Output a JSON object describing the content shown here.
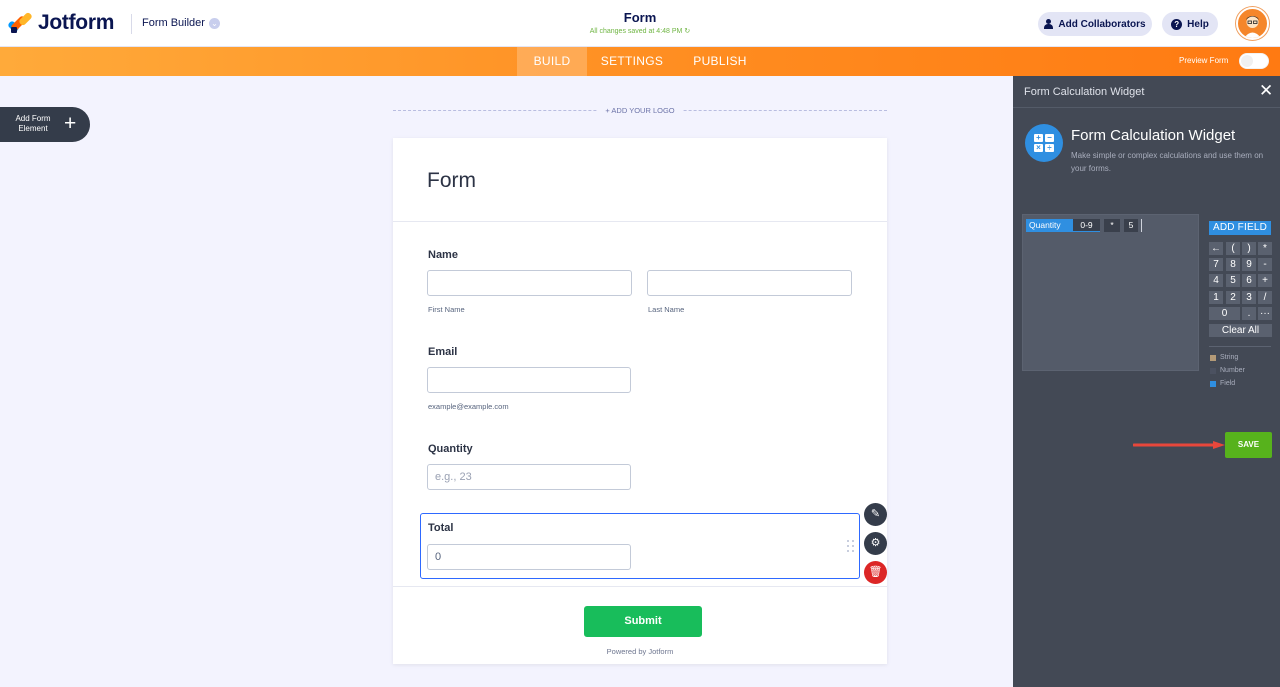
{
  "brand": {
    "name": "Jotform"
  },
  "header": {
    "builder_label": "Form Builder",
    "form_title": "Form",
    "saved_status": "All changes saved at 4:48 PM",
    "collaborators_label": "Add Collaborators",
    "help_label": "Help"
  },
  "nav": {
    "tabs": [
      {
        "label": "BUILD",
        "active": true
      },
      {
        "label": "SETTINGS",
        "active": false
      },
      {
        "label": "PUBLISH",
        "active": false
      }
    ],
    "preview_label": "Preview Form",
    "preview_on": false
  },
  "left": {
    "add_element_label": "Add Form Element"
  },
  "form": {
    "logo_placeholder": "+ ADD YOUR LOGO",
    "heading": "Form",
    "fields": {
      "name_label": "Name",
      "first_name_sub": "First Name",
      "last_name_sub": "Last Name",
      "email_label": "Email",
      "email_sub": "example@example.com",
      "quantity_label": "Quantity",
      "quantity_placeholder": "e.g., 23",
      "total_label": "Total",
      "total_value": "0"
    },
    "submit_label": "Submit",
    "powered_by": "Powered by Jotform"
  },
  "panel": {
    "title": "Form Calculation Widget",
    "widget_name": "Form Calculation Widget",
    "widget_desc": "Make simple or complex calculations and use them on your forms.",
    "formula": {
      "field": "Quantity",
      "range": "0-9",
      "operator": "*",
      "number": "5"
    },
    "add_field_label": "ADD FIELD",
    "keypad": [
      [
        "←",
        "(",
        ")",
        "*"
      ],
      [
        "7",
        "8",
        "9",
        "-"
      ],
      [
        "4",
        "5",
        "6",
        "+"
      ],
      [
        "1",
        "2",
        "3",
        "/"
      ],
      [
        "0",
        ".",
        "···"
      ]
    ],
    "clear_label": "Clear All",
    "legend": [
      {
        "label": "String",
        "color": "#b39a77"
      },
      {
        "label": "Number",
        "color": "#4b5160"
      },
      {
        "label": "Field",
        "color": "#2f8fe1"
      }
    ],
    "save_label": "SAVE"
  },
  "colors": {
    "accent": "#ff8a1e",
    "submit": "#18bd5b",
    "save": "#57b21c",
    "field": "#2f8fe1"
  }
}
